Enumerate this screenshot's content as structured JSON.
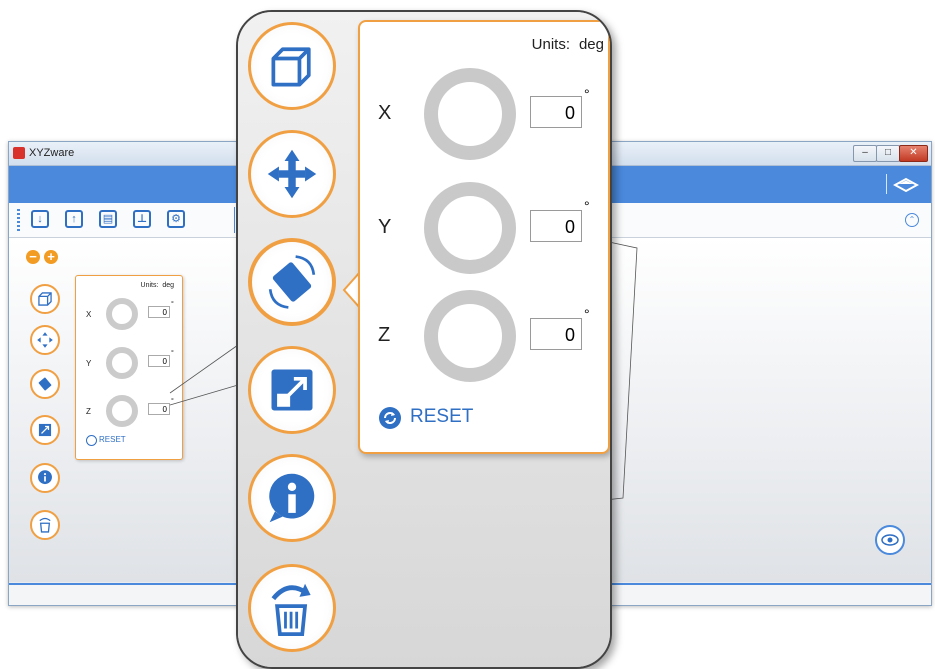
{
  "window": {
    "title": "XYZware",
    "controls": {
      "minimize": "‒",
      "maximize": "□",
      "close": "✕"
    }
  },
  "toolbar": {
    "icons": [
      "import-icon",
      "export-icon",
      "save-icon",
      "print-icon",
      "settings-icon"
    ]
  },
  "zoom_controls": {
    "minus": "−",
    "plus": "+"
  },
  "side_tools": [
    "view-cube-icon",
    "move-icon",
    "rotate-icon",
    "scale-icon",
    "info-icon",
    "delete-icon"
  ],
  "rotate_panel": {
    "units_label": "Units:",
    "units_value": "deg",
    "degree_symbol": "°",
    "axes": [
      {
        "label": "X",
        "value": "0"
      },
      {
        "label": "Y",
        "value": "0"
      },
      {
        "label": "Z",
        "value": "0"
      }
    ],
    "reset_label": "RESET"
  },
  "colors": {
    "accent_orange": "#f0a043",
    "ribbon_blue": "#4a89dc",
    "link_blue": "#2f6fc4",
    "ring_gray": "#c9c9c9"
  }
}
